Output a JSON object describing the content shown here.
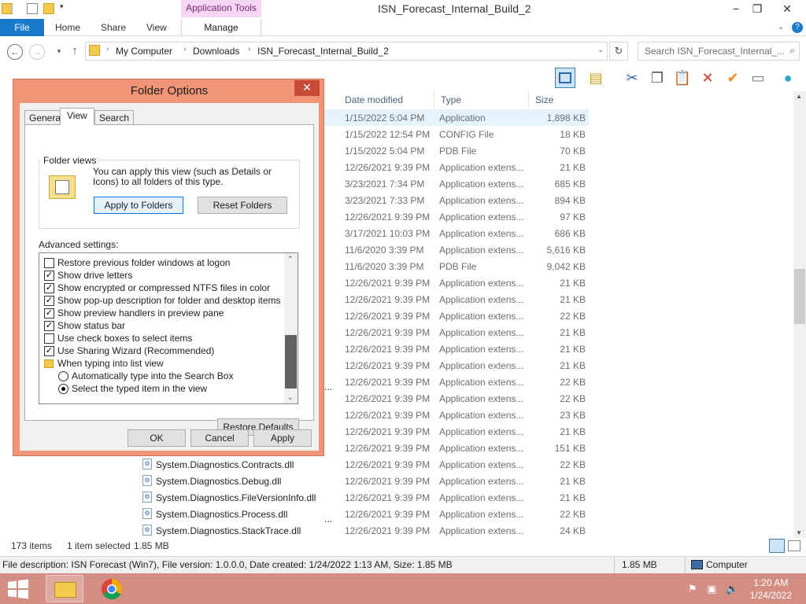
{
  "window": {
    "title": "ISN_Forecast_Internal_Build_2",
    "context_tab": "Application Tools",
    "minimize": "−",
    "restore": "❐",
    "close": "✕"
  },
  "ribbon": {
    "file": "File",
    "home": "Home",
    "share": "Share",
    "view": "View",
    "manage": "Manage"
  },
  "address": {
    "crumbs": [
      "My Computer",
      "Downloads",
      "ISN_Forecast_Internal_Build_2"
    ],
    "search_placeholder": "Search ISN_Forecast_Internal_..."
  },
  "columns": {
    "date": "Date modified",
    "type": "Type",
    "size": "Size"
  },
  "files": [
    {
      "name": "",
      "date": "1/15/2022 5:04 PM",
      "type": "Application",
      "size": "1,898 KB",
      "selected": true
    },
    {
      "name": "",
      "date": "1/15/2022 12:54 PM",
      "type": "CONFIG File",
      "size": "18 KB"
    },
    {
      "name": "",
      "date": "1/15/2022 5:04 PM",
      "type": "PDB File",
      "size": "70 KB"
    },
    {
      "name": "",
      "date": "12/26/2021 9:39 PM",
      "type": "Application extens...",
      "size": "21 KB"
    },
    {
      "name": "",
      "date": "3/23/2021 7:34 PM",
      "type": "Application extens...",
      "size": "685 KB"
    },
    {
      "name": "",
      "date": "3/23/2021 7:33 PM",
      "type": "Application extens...",
      "size": "894 KB"
    },
    {
      "name": "",
      "date": "12/26/2021 9:39 PM",
      "type": "Application extens...",
      "size": "97 KB"
    },
    {
      "name": "",
      "date": "3/17/2021 10:03 PM",
      "type": "Application extens...",
      "size": "686 KB"
    },
    {
      "name": "",
      "date": "11/6/2020 3:39 PM",
      "type": "Application extens...",
      "size": "5,616 KB"
    },
    {
      "name": "",
      "date": "11/6/2020 3:39 PM",
      "type": "PDB File",
      "size": "9,042 KB"
    },
    {
      "name": "",
      "date": "12/26/2021 9:39 PM",
      "type": "Application extens...",
      "size": "21 KB"
    },
    {
      "name": "",
      "date": "12/26/2021 9:39 PM",
      "type": "Application extens...",
      "size": "21 KB"
    },
    {
      "name": "",
      "date": "12/26/2021 9:39 PM",
      "type": "Application extens...",
      "size": "22 KB"
    },
    {
      "name": "",
      "date": "12/26/2021 9:39 PM",
      "type": "Application extens...",
      "size": "21 KB"
    },
    {
      "name": "",
      "date": "12/26/2021 9:39 PM",
      "type": "Application extens...",
      "size": "21 KB"
    },
    {
      "name": "",
      "date": "12/26/2021 9:39 PM",
      "type": "Application extens...",
      "size": "21 KB"
    },
    {
      "name": "",
      "date": "12/26/2021 9:39 PM",
      "type": "Application extens...",
      "size": "22 KB"
    },
    {
      "name": "",
      "date": "12/26/2021 9:39 PM",
      "type": "Application extens...",
      "size": "22 KB"
    },
    {
      "name": "",
      "date": "12/26/2021 9:39 PM",
      "type": "Application extens...",
      "size": "23 KB"
    },
    {
      "name": "",
      "date": "12/26/2021 9:39 PM",
      "type": "Application extens...",
      "size": "21 KB"
    },
    {
      "name": "",
      "date": "12/26/2021 9:39 PM",
      "type": "Application extens...",
      "size": "151 KB"
    },
    {
      "name": "System.Diagnostics.Contracts.dll",
      "date": "12/26/2021 9:39 PM",
      "type": "Application extens...",
      "size": "22 KB"
    },
    {
      "name": "System.Diagnostics.Debug.dll",
      "date": "12/26/2021 9:39 PM",
      "type": "Application extens...",
      "size": "21 KB"
    },
    {
      "name": "System.Diagnostics.FileVersionInfo.dll",
      "date": "12/26/2021 9:39 PM",
      "type": "Application extens...",
      "size": "21 KB"
    },
    {
      "name": "System.Diagnostics.Process.dll",
      "date": "12/26/2021 9:39 PM",
      "type": "Application extens...",
      "size": "22 KB"
    },
    {
      "name": "System.Diagnostics.StackTrace.dll",
      "date": "12/26/2021 9:39 PM",
      "type": "Application extens...",
      "size": "24 KB"
    }
  ],
  "partial_names": [
    "...",
    "..."
  ],
  "status": {
    "count": "173 items",
    "selected": "1 item selected",
    "selected_size": "1.85 MB"
  },
  "infobar": {
    "description": "File description: ISN Forecast (Win7), File version: 1.0.0.0, Date created: 1/24/2022 1:13 AM, Size: 1.85 MB",
    "size": "1.85 MB",
    "location": "Computer"
  },
  "taskbar": {
    "time": "1:20 AM",
    "date": "1/24/2022"
  },
  "dialog": {
    "title": "Folder Options",
    "close": "✕",
    "tabs": [
      "General",
      "View",
      "Search"
    ],
    "active_tab": "View",
    "folder_views_label": "Folder views",
    "folder_views_text": "You can apply this view (such as Details or Icons) to all folders of this type.",
    "apply_to_folders": "Apply to Folders",
    "reset_folders": "Reset Folders",
    "advanced_label": "Advanced settings:",
    "advanced_items": [
      {
        "kind": "checkbox",
        "label": "Restore previous folder windows at logon",
        "checked": false
      },
      {
        "kind": "checkbox",
        "label": "Show drive letters",
        "checked": true
      },
      {
        "kind": "checkbox",
        "label": "Show encrypted or compressed NTFS files in color",
        "checked": true
      },
      {
        "kind": "checkbox",
        "label": "Show pop-up description for folder and desktop items",
        "checked": true
      },
      {
        "kind": "checkbox",
        "label": "Show preview handlers in preview pane",
        "checked": true
      },
      {
        "kind": "checkbox",
        "label": "Show status bar",
        "checked": true
      },
      {
        "kind": "checkbox",
        "label": "Use check boxes to select items",
        "checked": false
      },
      {
        "kind": "checkbox",
        "label": "Use Sharing Wizard (Recommended)",
        "checked": true
      },
      {
        "kind": "folder",
        "label": "When typing into list view"
      },
      {
        "kind": "radio",
        "label": "Automatically type into the Search Box",
        "checked": false
      },
      {
        "kind": "radio",
        "label": "Select the typed item in the view",
        "checked": true
      }
    ],
    "restore_defaults": "Restore Defaults",
    "ok": "OK",
    "cancel": "Cancel",
    "apply": "Apply"
  },
  "colors": {
    "dialog_frame": "#f09477",
    "file_tab": "#1979ca",
    "context_tab": "#f7d6f3",
    "taskbar": "#d48d83",
    "selection": "#e5f3ff"
  }
}
